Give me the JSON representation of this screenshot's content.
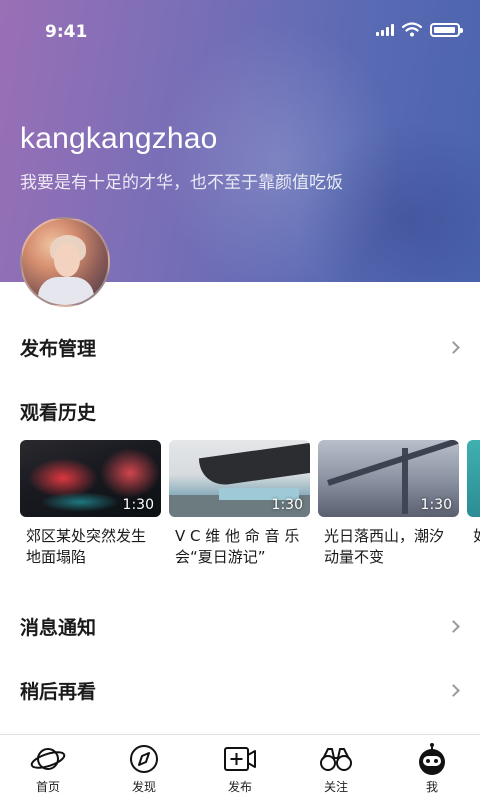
{
  "status_bar": {
    "time": "9:41"
  },
  "profile": {
    "username": "kangkangzhao",
    "signature": "我要是有十足的才华，也不至于靠颜值吃饭"
  },
  "menu": {
    "publish_manage": "发布管理",
    "history_title": "观看历史",
    "notifications": "消息通知",
    "watch_later": "稍后再看"
  },
  "history": [
    {
      "title": "郊区某处突然发生地面塌陷",
      "duration": "1:30"
    },
    {
      "title": "V C 维 他 命 音 乐会“夏日游记”",
      "duration": "1:30"
    },
    {
      "title": "光日落西山，潮汐动量不变",
      "duration": "1:30"
    },
    {
      "title": "如不",
      "duration": ""
    }
  ],
  "tabs": [
    {
      "label": "首页",
      "icon": "planet-icon"
    },
    {
      "label": "发现",
      "icon": "compass-icon"
    },
    {
      "label": "发布",
      "icon": "video-add-icon"
    },
    {
      "label": "关注",
      "icon": "binoculars-icon"
    },
    {
      "label": "我",
      "icon": "robot-icon"
    }
  ]
}
